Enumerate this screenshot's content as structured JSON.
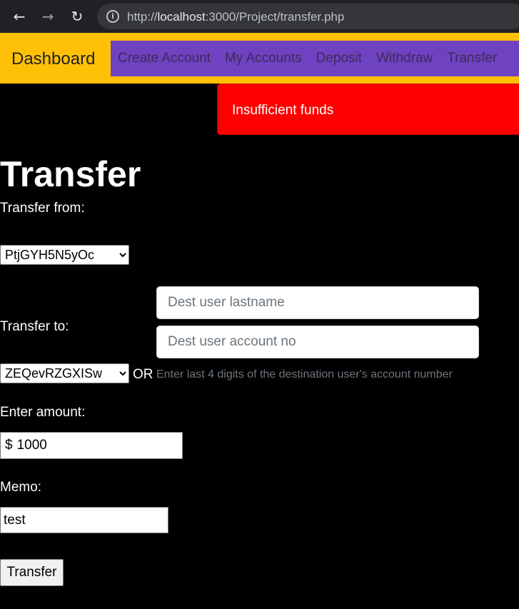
{
  "browser": {
    "url_prefix": "http://",
    "url_host": "localhost",
    "url_rest": ":3000/Project/transfer.php"
  },
  "navbar": {
    "brand": "Dashboard",
    "links": [
      "Create Account",
      "My Accounts",
      "Deposit",
      "Withdraw",
      "Transfer"
    ]
  },
  "alert": {
    "message": "Insufficient funds"
  },
  "page": {
    "title": "Transfer"
  },
  "form": {
    "from_label": "Transfer from:",
    "from_selected": "PtjGYH5N5yOc",
    "to_label": "Transfer to:",
    "dest_lastname_placeholder": "Dest user lastname",
    "dest_account_placeholder": "Dest user account no",
    "to_selected": "ZEQevRZGXISw",
    "or_label": "OR",
    "hint": "Enter last 4 digits of the destination user's account number",
    "amount_label": "Enter amount:",
    "currency_symbol": "$",
    "amount_value": "1000",
    "memo_label": "Memo:",
    "memo_value": "test",
    "submit_label": "Transfer"
  },
  "colors": {
    "navbar": "#ffc107",
    "nav_links_bg": "#6f42c1",
    "alert": "#ff0000",
    "page_bg": "#000000"
  }
}
